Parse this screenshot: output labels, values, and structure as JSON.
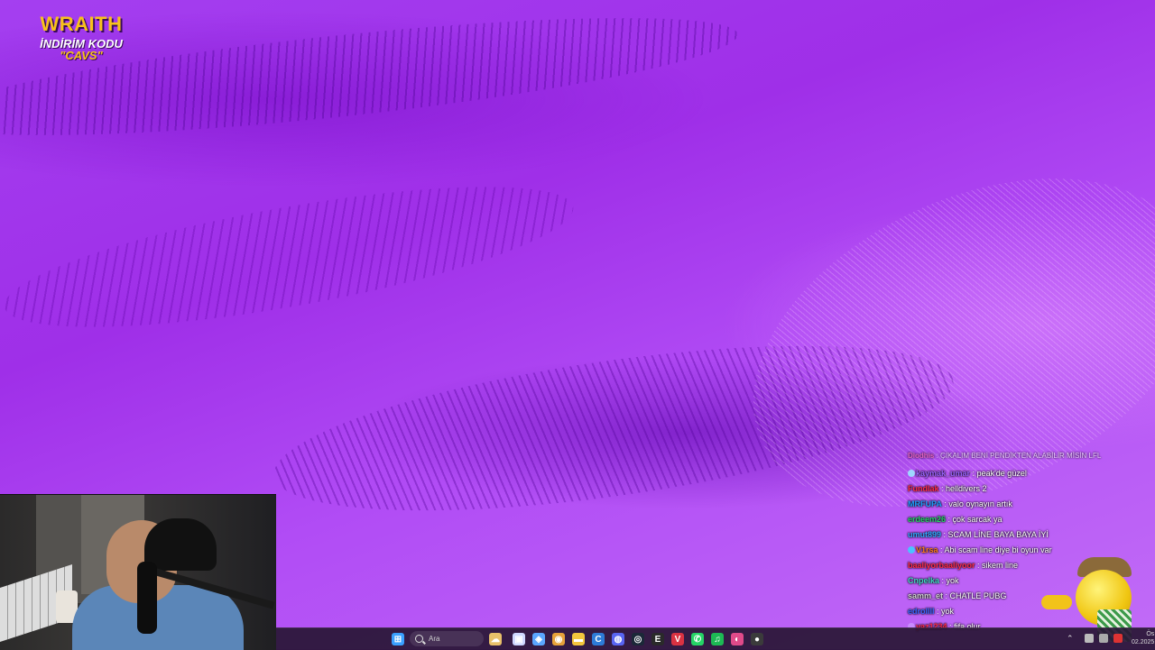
{
  "overlay": {
    "brand": "WRAITH",
    "subtitle": "İNDİRİM KODU",
    "code": "\"CAVS\""
  },
  "chat": {
    "messages": [
      {
        "user": "Diodhis",
        "text": "ÇIKALIM BENİ PENDİKTEN ALABİLİR MİSİN LFL",
        "color": "#ff6aa8",
        "faded": true
      },
      {
        "user": "kaymak_umar",
        "text": "peak'de güzel",
        "color": "#9b62ff",
        "badge": "#9fd6ff"
      },
      {
        "user": "Fundlak",
        "text": "helldivers 2",
        "color": "#ff2a4a"
      },
      {
        "user": "MRFUPA",
        "text": "valo oynayın artık",
        "color": "#1f9dff"
      },
      {
        "user": "erdeem26",
        "text": "çok sarcak ya",
        "color": "#24d36a"
      },
      {
        "user": "umut899",
        "text": "SCAM LİNE BAYA BAYA İYİ",
        "color": "#30a8ff"
      },
      {
        "user": "V1rsa",
        "text": "Abi scam line diye bi oyun var",
        "color": "#ff7a1a",
        "badge": "#4bc3ff"
      },
      {
        "user": "baaliyorbaaliyoor",
        "text": "sikem line",
        "color": "#ff2a4a"
      },
      {
        "user": "Cnpelka",
        "text": "yok",
        "color": "#40d7c4"
      },
      {
        "user": "samm_et",
        "text": "CHATLE PUBG",
        "color": "#d4d4d4"
      },
      {
        "user": "edrollll",
        "text": "yok",
        "color": "#3a66ff"
      },
      {
        "user": "yaz1234",
        "text": "fifa olur",
        "color": "#ff2a4a",
        "badge": "#c98bff"
      }
    ]
  },
  "taskbar": {
    "search_placeholder": "Ara",
    "clock_time": "Ös",
    "clock_date": "02.2025",
    "icons": [
      {
        "name": "windows-start-icon",
        "color": "#3aa0ff",
        "glyph": "⊞"
      },
      {
        "name": "weather-widget-icon",
        "color": "#e8c06a",
        "glyph": "☁"
      },
      {
        "name": "task-view-icon",
        "color": "#cfd8ff",
        "glyph": "▣"
      },
      {
        "name": "copilot-icon",
        "color": "#5aa6ff",
        "glyph": "◈"
      },
      {
        "name": "chrome-icon",
        "color": "#e6a23a",
        "glyph": "◉"
      },
      {
        "name": "file-explorer-icon",
        "color": "#f3c63d",
        "glyph": "▬"
      },
      {
        "name": "ccleaner-icon",
        "color": "#2d7bd8",
        "glyph": "C"
      },
      {
        "name": "discord-icon",
        "color": "#5865f2",
        "glyph": "◍"
      },
      {
        "name": "steam-icon",
        "color": "#1b2838",
        "glyph": "◎"
      },
      {
        "name": "epic-games-icon",
        "color": "#2a2a2a",
        "glyph": "E"
      },
      {
        "name": "valorant-icon",
        "color": "#d93242",
        "glyph": "V"
      },
      {
        "name": "whatsapp-icon",
        "color": "#25d366",
        "glyph": "✆"
      },
      {
        "name": "spotify-icon",
        "color": "#1db954",
        "glyph": "♫"
      },
      {
        "name": "browser-icon",
        "color": "#e04a8a",
        "glyph": "◐"
      },
      {
        "name": "obs-icon",
        "color": "#3b3b3b",
        "glyph": "●"
      }
    ]
  }
}
